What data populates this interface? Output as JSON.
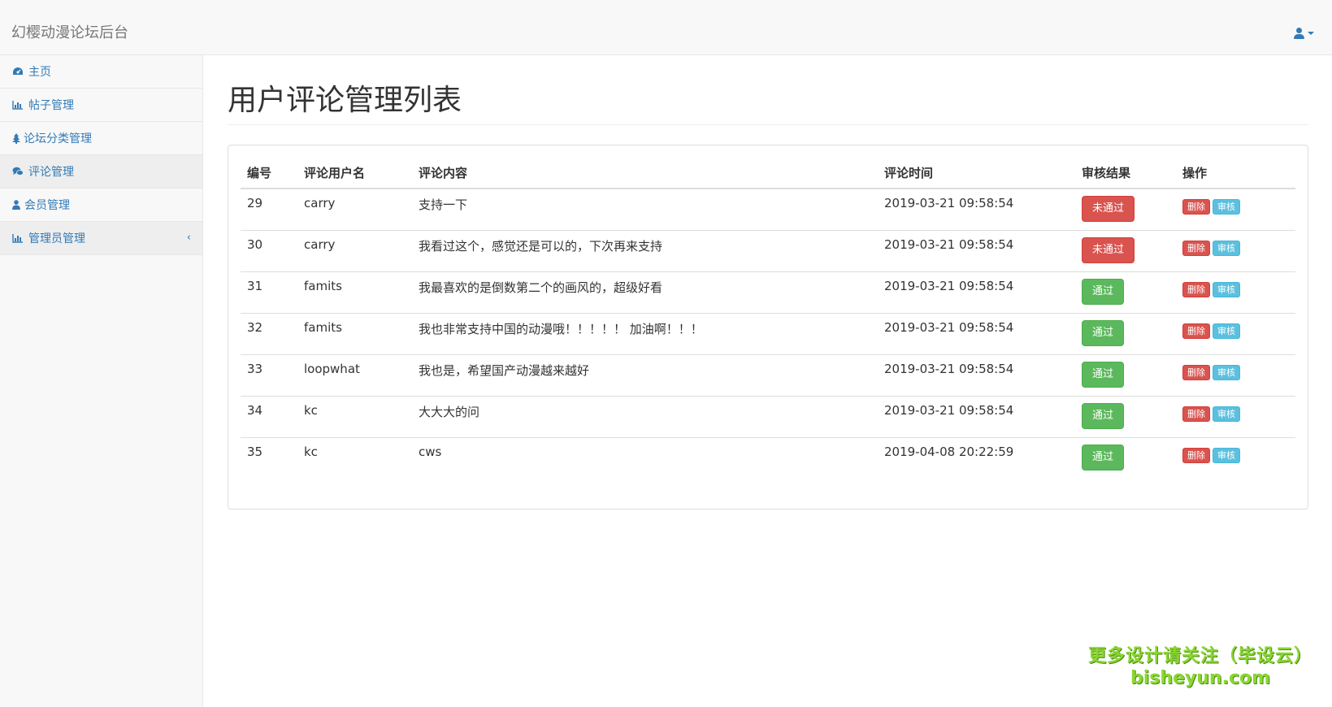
{
  "navbar": {
    "brand": "幻樱动漫论坛后台",
    "user_icon": "user-icon"
  },
  "sidebar": {
    "items": [
      {
        "label": "主页",
        "icon": "dashboard-icon"
      },
      {
        "label": "帖子管理",
        "icon": "bar-chart-icon"
      },
      {
        "label": "论坛分类管理",
        "icon": "tree-icon"
      },
      {
        "label": "评论管理",
        "icon": "comments-icon"
      },
      {
        "label": "会员管理",
        "icon": "user-icon"
      },
      {
        "label": "管理员管理",
        "icon": "bar-chart-icon"
      }
    ],
    "arrow": "‹"
  },
  "main": {
    "title": "用户评论管理列表"
  },
  "table": {
    "headers": [
      "编号",
      "评论用户名",
      "评论内容",
      "评论时间",
      "审核结果",
      "操作"
    ],
    "rows": [
      {
        "id": "29",
        "user": "carry",
        "content": "支持一下",
        "time": "2019-03-21 09:58:54",
        "status": "未通过",
        "passed": false
      },
      {
        "id": "30",
        "user": "carry",
        "content": "我看过这个，感觉还是可以的，下次再来支持",
        "time": "2019-03-21 09:58:54",
        "status": "未通过",
        "passed": false
      },
      {
        "id": "31",
        "user": "famits",
        "content": "我最喜欢的是倒数第二个的画风的，超级好看",
        "time": "2019-03-21 09:58:54",
        "status": "通过",
        "passed": true
      },
      {
        "id": "32",
        "user": "famits",
        "content": "我也非常支持中国的动漫哦！！！！！ 加油啊！！！",
        "time": "2019-03-21 09:58:54",
        "status": "通过",
        "passed": true
      },
      {
        "id": "33",
        "user": "loopwhat",
        "content": "我也是，希望国产动漫越来越好",
        "time": "2019-03-21 09:58:54",
        "status": "通过",
        "passed": true
      },
      {
        "id": "34",
        "user": "kc",
        "content": "大大大的问",
        "time": "2019-03-21 09:58:54",
        "status": "通过",
        "passed": true
      },
      {
        "id": "35",
        "user": "kc",
        "content": "cws",
        "time": "2019-04-08 20:22:59",
        "status": "通过",
        "passed": true
      }
    ],
    "delete_label": "删除",
    "audit_label": "审核"
  },
  "watermark": {
    "line1": "更多设计请关注（毕设云）",
    "line2": "bisheyun.com"
  },
  "colors": {
    "link": "#337ab7",
    "danger": "#d9534f",
    "success": "#5cb85c",
    "info": "#5bc0de"
  }
}
